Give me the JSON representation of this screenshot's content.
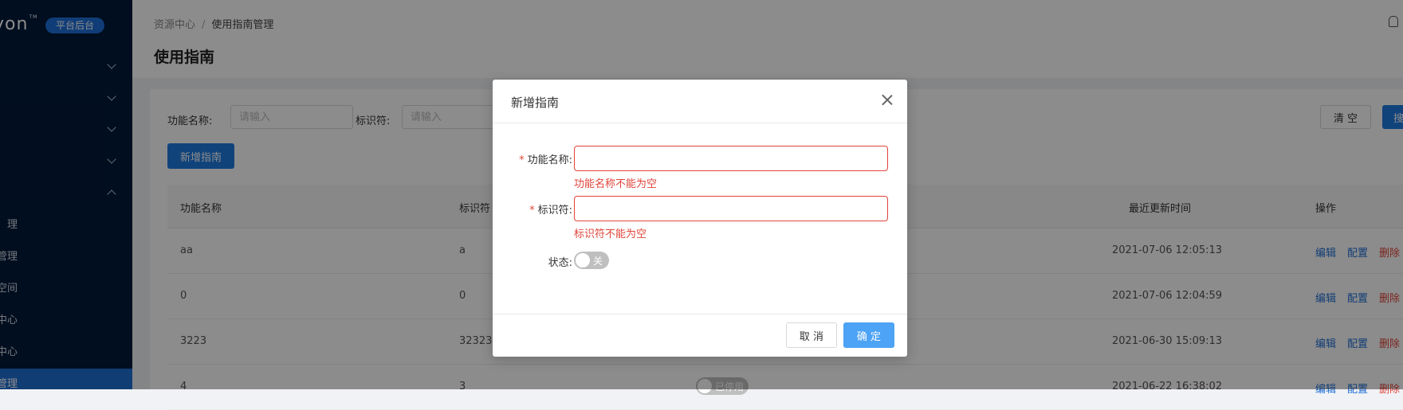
{
  "sidebar": {
    "logo_text": "yon",
    "logo_tm": "TM",
    "badge": "平台后台",
    "sub_items": [
      "理",
      "管理",
      "空间",
      "中心",
      "中心",
      "指南管理"
    ]
  },
  "header": {
    "breadcrumb": [
      "资源中心",
      "使用指南管理"
    ],
    "breadcrumb_sep": "/",
    "title": "使用指南"
  },
  "filters": {
    "name_label": "功能名称:",
    "name_placeholder": "请输入",
    "id_label": "标识符:",
    "id_placeholder": "请输入",
    "clear_label": "清 空",
    "search_label": "搜"
  },
  "add_button": "新增指南",
  "table": {
    "columns": [
      "功能名称",
      "标识符",
      "最近更新时间",
      "操作"
    ],
    "rows": [
      {
        "name": "aa",
        "id": "a",
        "updated": "2021-07-06 12:05:13"
      },
      {
        "name": "0",
        "id": "0",
        "updated": "2021-07-06 12:04:59"
      },
      {
        "name": "3223",
        "id": "32323",
        "updated": "2021-06-30 15:09:13"
      },
      {
        "name": "4",
        "id": "3",
        "updated": "2021-06-22 16:38:02",
        "status": "已停用"
      }
    ],
    "ops": [
      "编辑",
      "配置",
      "删除"
    ]
  },
  "dialog": {
    "title": "新增指南",
    "fields": [
      {
        "label": "功能名称:",
        "required_mark": "*",
        "error": "功能名称不能为空"
      },
      {
        "label": "标识符:",
        "required_mark": "*",
        "error": "标识符不能为空"
      }
    ],
    "status_label": "状态:",
    "switch_text": "关",
    "cancel": "取 消",
    "ok": "确 定"
  },
  "colors": {
    "sidebar_bg": "#031a3a",
    "primary": "#1f7ae0",
    "error": "#e0443a"
  }
}
